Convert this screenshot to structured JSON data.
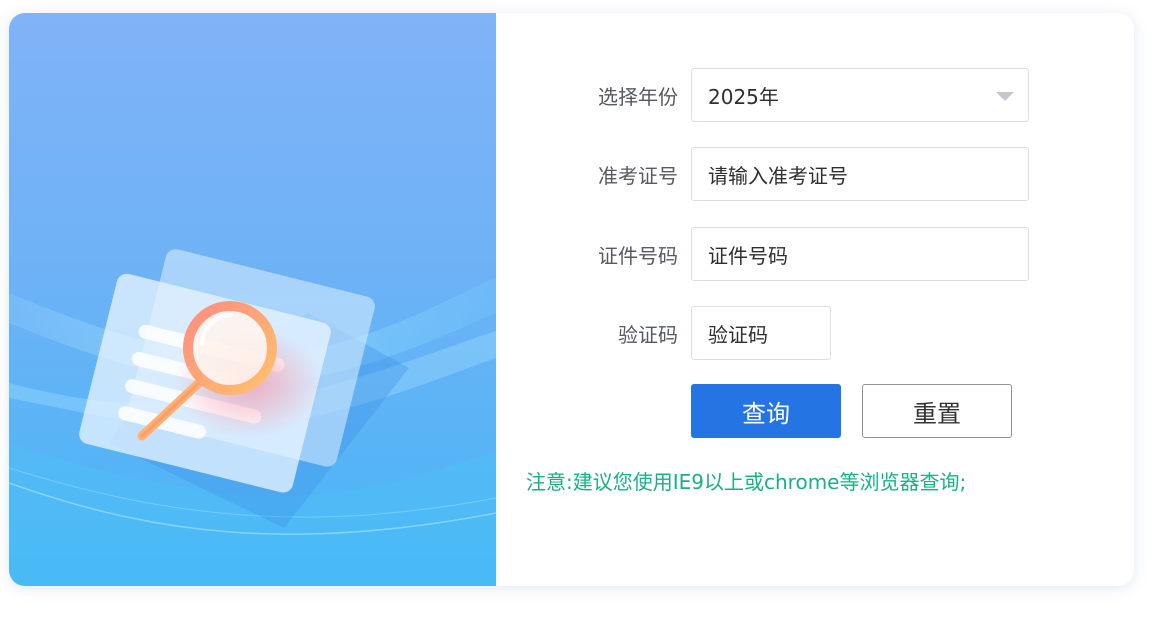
{
  "form": {
    "year": {
      "label": "选择年份",
      "value": "2025年"
    },
    "exam_number": {
      "label": "准考证号",
      "value": "请输入准考证号"
    },
    "id_number": {
      "label": "证件号码",
      "value": "证件号码"
    },
    "captcha": {
      "label": "验证码",
      "value": "验证码"
    }
  },
  "buttons": {
    "query": "查询",
    "reset": "重置"
  },
  "notice": "注意:建议您使用IE9以上或chrome等浏览器查询;",
  "colors": {
    "primary": "#2574e3",
    "notice": "#17b088",
    "hero_top": "#80b3f8",
    "hero_bottom": "#46b6f6"
  },
  "icons": {
    "hero": "magnifier-document-illustration",
    "dropdown": "chevron-down-icon"
  }
}
